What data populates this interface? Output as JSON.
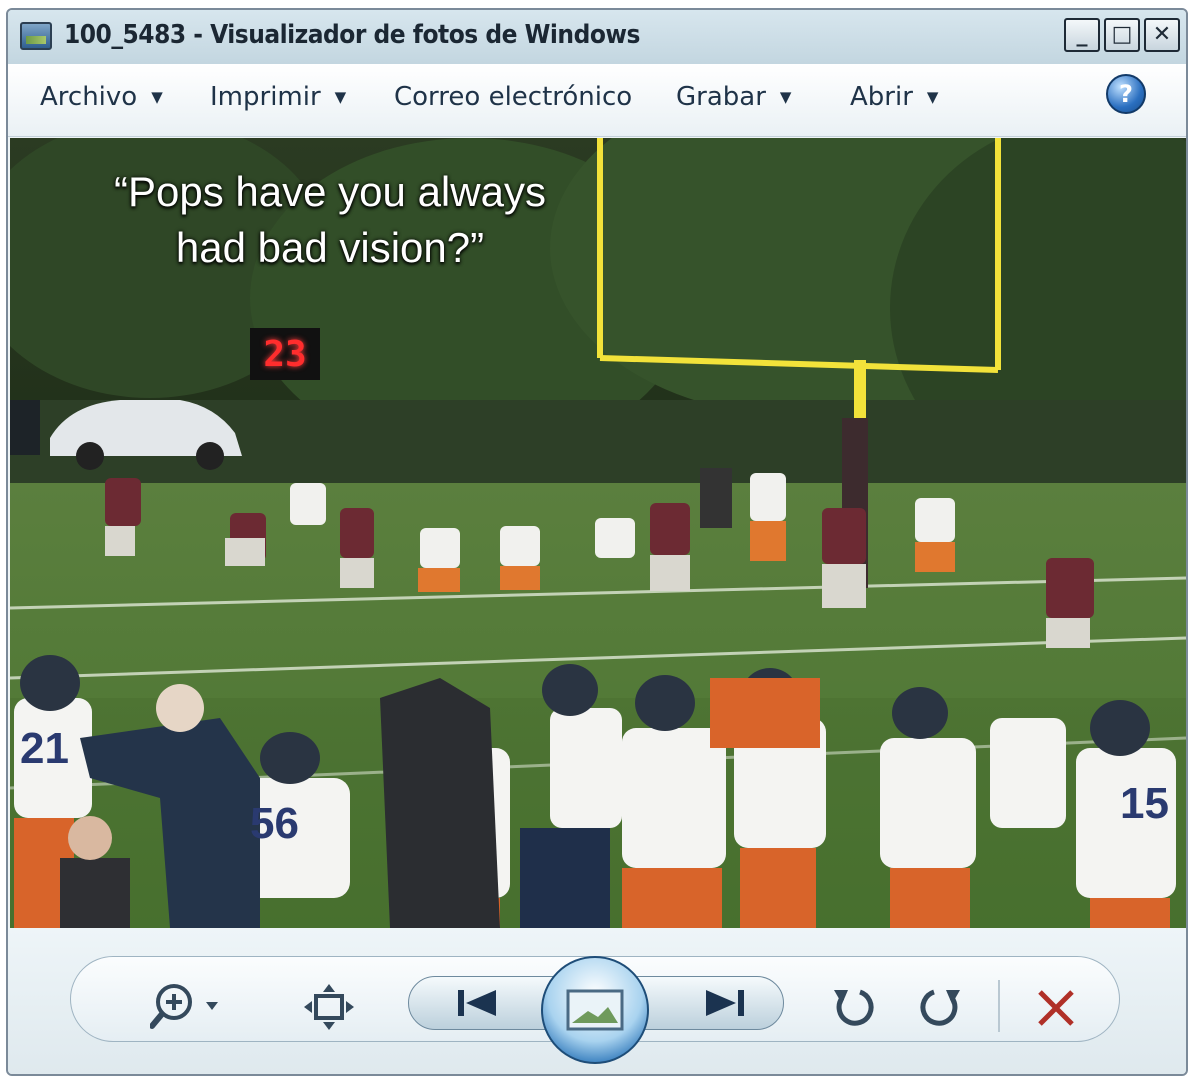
{
  "window": {
    "title": "100_5483 - Visualizador de fotos de Windows",
    "icon": "photo-viewer-icon",
    "controls": {
      "minimize": "_",
      "maximize": "□",
      "close": "✕"
    }
  },
  "menu": {
    "items": [
      {
        "label": "Archivo",
        "has_dropdown": true
      },
      {
        "label": "Imprimir",
        "has_dropdown": true
      },
      {
        "label": "Correo electrónico",
        "has_dropdown": false
      },
      {
        "label": "Grabar",
        "has_dropdown": true
      },
      {
        "label": "Abrir",
        "has_dropdown": true
      }
    ],
    "help": "?"
  },
  "photo": {
    "caption_line1": "“Pops have you always",
    "caption_line2": "had bad vision?”",
    "scoreboard": "23"
  },
  "toolbar": {
    "zoom": "zoom-icon",
    "fit": "actual-size-icon",
    "previous": "previous-icon",
    "slideshow": "slideshow-icon",
    "next": "next-icon",
    "rotate_left": "rotate-counterclockwise-icon",
    "rotate_right": "rotate-clockwise-icon",
    "delete": "delete-icon"
  },
  "colors": {
    "accent_blue": "#2a74b8",
    "delete_red": "#b03028",
    "goalpost_yellow": "#f2e23a",
    "field_green": "#4f7a35"
  }
}
